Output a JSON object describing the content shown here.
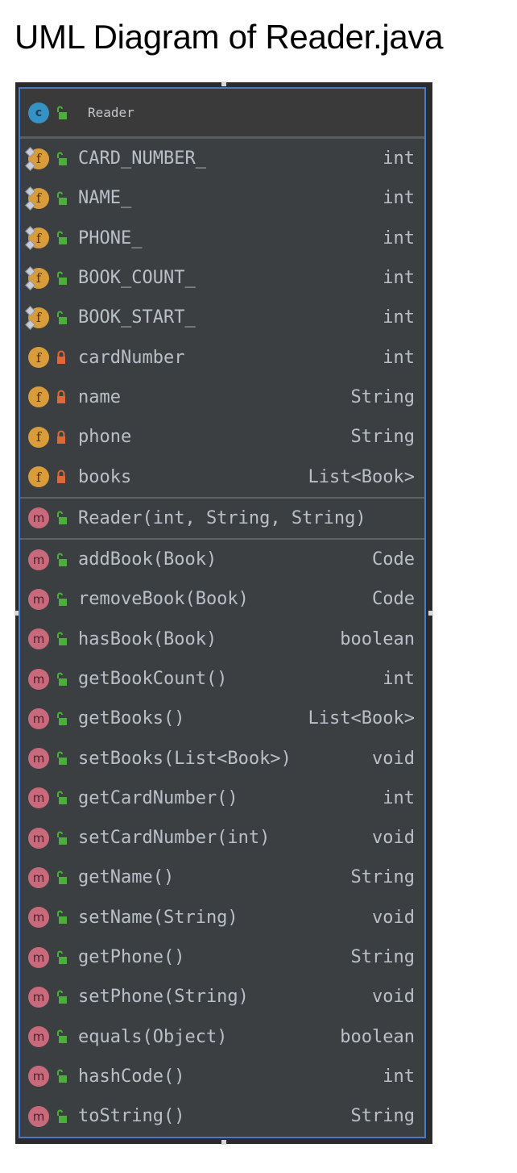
{
  "page": {
    "title": "UML Diagram of Reader.java"
  },
  "class": {
    "kind_icon": "class-icon",
    "visibility": "public",
    "name": "Reader"
  },
  "colors": {
    "class_badge": "#3592c4",
    "field_badge": "#d99c3a",
    "method_badge": "#c86a7c",
    "public_lock": "#4caf3c",
    "private_lock": "#e0673a",
    "selection_border": "#4a7bbf",
    "background": "#3c3f41"
  },
  "fields": [
    {
      "name": "CARD_NUMBER_",
      "type": "int",
      "visibility": "public",
      "static": true
    },
    {
      "name": "NAME_",
      "type": "int",
      "visibility": "public",
      "static": true
    },
    {
      "name": "PHONE_",
      "type": "int",
      "visibility": "public",
      "static": true
    },
    {
      "name": "BOOK_COUNT_",
      "type": "int",
      "visibility": "public",
      "static": true
    },
    {
      "name": "BOOK_START_",
      "type": "int",
      "visibility": "public",
      "static": true
    },
    {
      "name": "cardNumber",
      "type": "int",
      "visibility": "private",
      "static": false
    },
    {
      "name": "name",
      "type": "String",
      "visibility": "private",
      "static": false
    },
    {
      "name": "phone",
      "type": "String",
      "visibility": "private",
      "static": false
    },
    {
      "name": "books",
      "type": "List<Book>",
      "visibility": "private",
      "static": false
    }
  ],
  "constructors": [
    {
      "name": "Reader(int, String, String)",
      "type": "",
      "visibility": "public"
    }
  ],
  "methods": [
    {
      "name": "addBook(Book)",
      "type": "Code",
      "visibility": "public"
    },
    {
      "name": "removeBook(Book)",
      "type": "Code",
      "visibility": "public"
    },
    {
      "name": "hasBook(Book)",
      "type": "boolean",
      "visibility": "public"
    },
    {
      "name": "getBookCount()",
      "type": "int",
      "visibility": "public"
    },
    {
      "name": "getBooks()",
      "type": "List<Book>",
      "visibility": "public"
    },
    {
      "name": "setBooks(List<Book>)",
      "type": "void",
      "visibility": "public"
    },
    {
      "name": "getCardNumber()",
      "type": "int",
      "visibility": "public"
    },
    {
      "name": "setCardNumber(int)",
      "type": "void",
      "visibility": "public"
    },
    {
      "name": "getName()",
      "type": "String",
      "visibility": "public"
    },
    {
      "name": "setName(String)",
      "type": "void",
      "visibility": "public"
    },
    {
      "name": "getPhone()",
      "type": "String",
      "visibility": "public"
    },
    {
      "name": "setPhone(String)",
      "type": "void",
      "visibility": "public"
    },
    {
      "name": "equals(Object)",
      "type": "boolean",
      "visibility": "public"
    },
    {
      "name": "hashCode()",
      "type": "int",
      "visibility": "public"
    },
    {
      "name": "toString()",
      "type": "String",
      "visibility": "public"
    }
  ],
  "badge_letters": {
    "class": "c",
    "field": "f",
    "method": "m"
  }
}
